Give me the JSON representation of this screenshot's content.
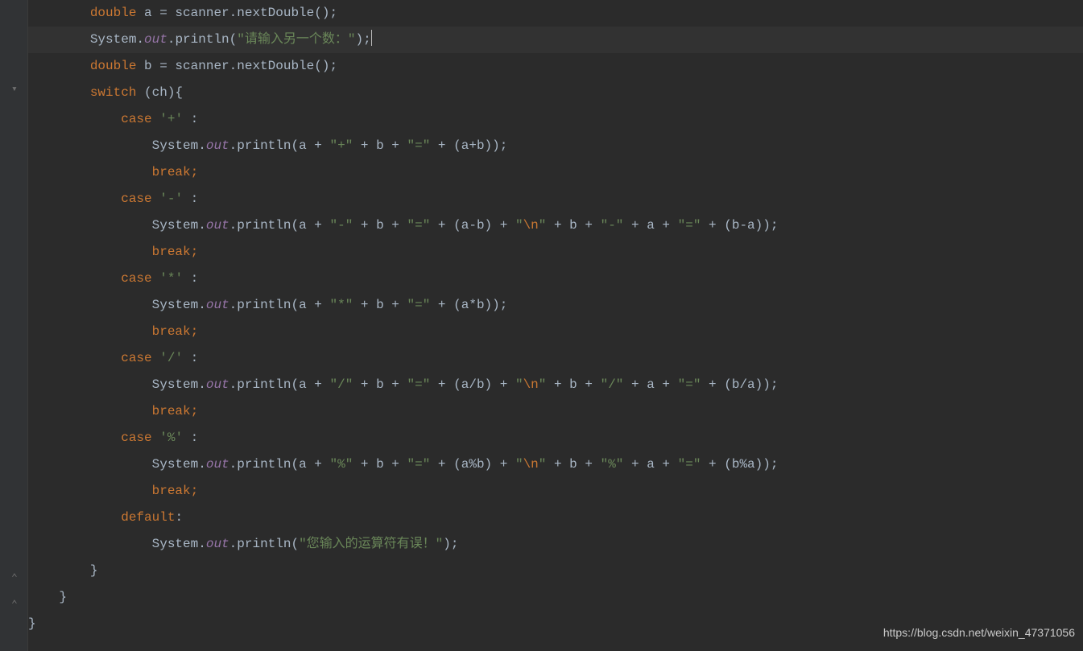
{
  "code": {
    "l1": {
      "kw": "double",
      "rest1": " a = scanner.nextDouble();"
    },
    "l2": {
      "pre": "System.",
      "out": "out",
      "mid": ".println(",
      "str": "\"请输入另一个数：\"",
      "post": ");"
    },
    "l3": {
      "kw": "double",
      "rest1": " b = scanner.nextDouble();"
    },
    "l4": {
      "kw": "switch",
      "rest1": " (ch){"
    },
    "l5": {
      "kw": "case ",
      "ch": "'+'",
      "rest1": " :"
    },
    "l6": {
      "pre": "System.",
      "out": "out",
      "mid": ".println(a + ",
      "s1": "\"+\"",
      "m1": " + b + ",
      "s2": "\"=\"",
      "post": " + (a+b));"
    },
    "l7": {
      "kw": "break;"
    },
    "l8": {
      "kw": "case ",
      "ch": "'-'",
      "rest1": " :"
    },
    "l9": {
      "pre": "System.",
      "out": "out",
      "mid": ".println(a + ",
      "s1": "\"-\"",
      "m1": " + b + ",
      "s2": "\"=\"",
      "m2": " + (a-b) + ",
      "s3_a": "\"",
      "s3_esc": "\\n",
      "s3_b": "\"",
      "m3": " + b + ",
      "s4": "\"-\"",
      "m4": " + a + ",
      "s5": "\"=\"",
      "post": " + (b-a));"
    },
    "l10": {
      "kw": "break;"
    },
    "l11": {
      "kw": "case ",
      "ch": "'*'",
      "rest1": " :"
    },
    "l12": {
      "pre": "System.",
      "out": "out",
      "mid": ".println(a + ",
      "s1": "\"*\"",
      "m1": " + b + ",
      "s2": "\"=\"",
      "post": " + (a*b));"
    },
    "l13": {
      "kw": "break;"
    },
    "l14": {
      "kw": "case ",
      "ch": "'/'",
      "rest1": " :"
    },
    "l15": {
      "pre": "System.",
      "out": "out",
      "mid": ".println(a + ",
      "s1": "\"/\"",
      "m1": " + b + ",
      "s2": "\"=\"",
      "m2": " + (a/b) + ",
      "s3_a": "\"",
      "s3_esc": "\\n",
      "s3_b": "\"",
      "m3": " + b + ",
      "s4": "\"/\"",
      "m4": " + a + ",
      "s5": "\"=\"",
      "post": " + (b/a));"
    },
    "l16": {
      "kw": "break;"
    },
    "l17": {
      "kw": "case ",
      "ch": "'%'",
      "rest1": " :"
    },
    "l18": {
      "pre": "System.",
      "out": "out",
      "mid": ".println(a + ",
      "s1": "\"%\"",
      "m1": " + b + ",
      "s2": "\"=\"",
      "m2": " + (a%b) + ",
      "s3_a": "\"",
      "s3_esc": "\\n",
      "s3_b": "\"",
      "m3": " + b + ",
      "s4": "\"%\"",
      "m4": " + a + ",
      "s5": "\"=\"",
      "post": " + (b%a));"
    },
    "l19": {
      "kw": "break;"
    },
    "l20": {
      "kw": "default",
      "rest1": ":"
    },
    "l21": {
      "pre": "System.",
      "out": "out",
      "mid": ".println(",
      "str": "\"您输入的运算符有误！\"",
      "post": ");"
    },
    "l22": {
      "rest1": "}"
    },
    "l23": {
      "rest1": "}"
    },
    "l24": {
      "rest1": "}"
    }
  },
  "indent": {
    "i2": "        ",
    "i3": "            ",
    "i4": "                ",
    "i1": "    ",
    "i0": ""
  },
  "watermark": "https://blog.csdn.net/weixin_47371056"
}
